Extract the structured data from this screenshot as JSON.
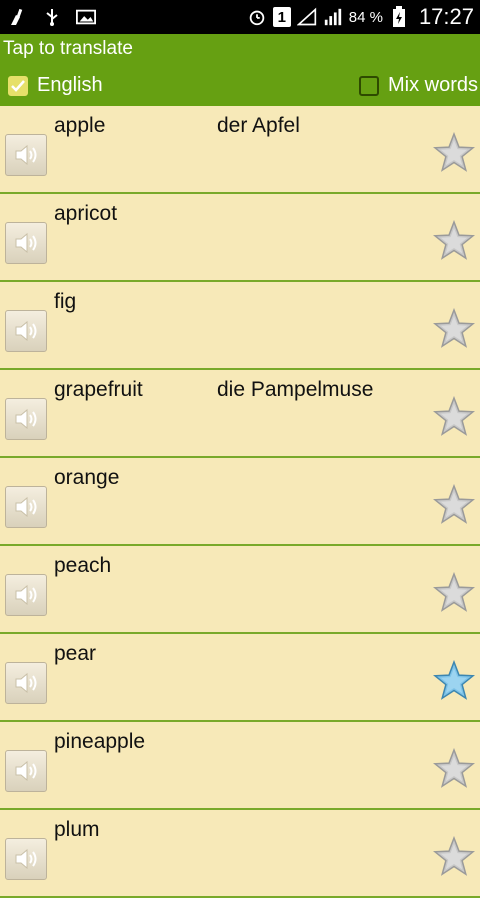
{
  "status": {
    "battery": "84 %",
    "time": "17:27",
    "sim": "1"
  },
  "header": {
    "title": "Tap to translate",
    "english_label": "English",
    "english_checked": true,
    "mix_label": "Mix words",
    "mix_checked": false
  },
  "words": [
    {
      "word": "apple",
      "translation": "der Apfel",
      "favorite": false
    },
    {
      "word": "apricot",
      "translation": "",
      "favorite": false
    },
    {
      "word": "fig",
      "translation": "",
      "favorite": false
    },
    {
      "word": "grapefruit",
      "translation": "die Pampelmuse",
      "favorite": false
    },
    {
      "word": "orange",
      "translation": "",
      "favorite": false
    },
    {
      "word": "peach",
      "translation": "",
      "favorite": false
    },
    {
      "word": "pear",
      "translation": "",
      "favorite": true
    },
    {
      "word": "pineapple",
      "translation": "",
      "favorite": false
    },
    {
      "word": "plum",
      "translation": "",
      "favorite": false
    }
  ],
  "colors": {
    "header": "#66A012",
    "background": "#F7E9B8",
    "divider": "#79A92A",
    "star_active": "#7EC3E8",
    "star_inactive": "#C8C8C8"
  }
}
